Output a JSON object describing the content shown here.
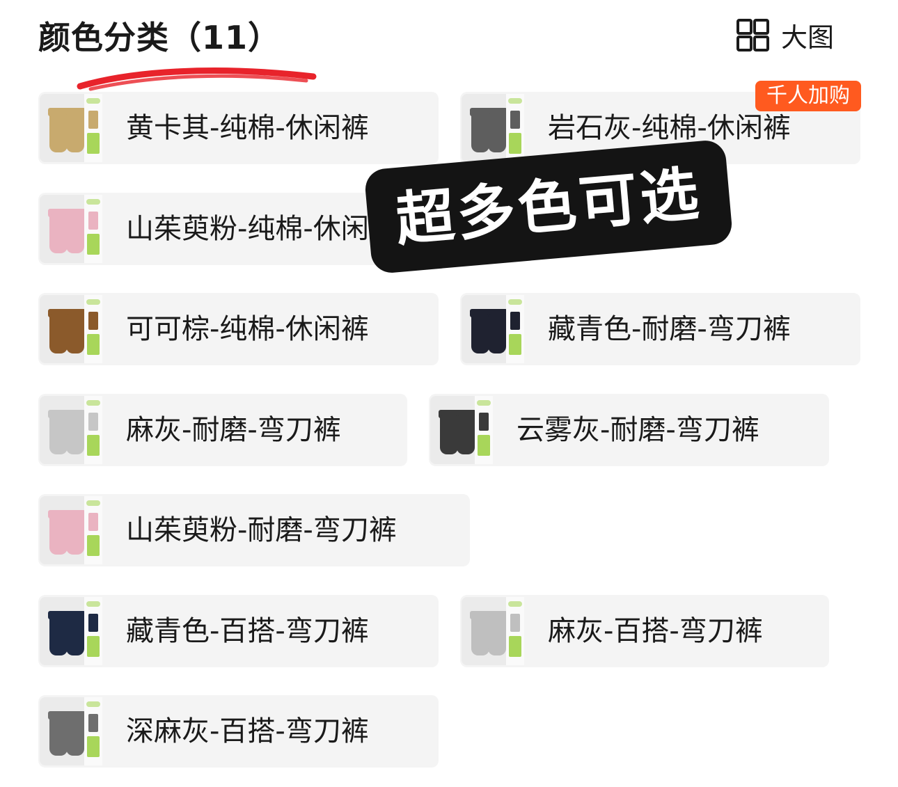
{
  "header": {
    "title": "颜色分类（11）",
    "view_label": "大图",
    "view_icon": "grid-icon"
  },
  "badge": "千人加购",
  "overlay_text": "超多色可选",
  "colors": {
    "accent_underline": "#e8232b",
    "badge_bg": "#ff5a1f",
    "chip_bg": "#f4f4f4",
    "overlay_bg": "#141414"
  },
  "options": [
    {
      "label": "黄卡其-纯棉-休闲裤",
      "swatch": "#c8aa6e"
    },
    {
      "label": "岩石灰-纯棉-休闲裤",
      "swatch": "#5e5e5e"
    },
    {
      "label": "山茱萸粉-纯棉-休闲裤",
      "swatch": "#eab3c1"
    },
    {
      "label": "可可棕-纯棉-休闲裤",
      "swatch": "#8b5a2b"
    },
    {
      "label": "藏青色-耐磨-弯刀裤",
      "swatch": "#1f2230"
    },
    {
      "label": "麻灰-耐磨-弯刀裤",
      "swatch": "#c6c6c6"
    },
    {
      "label": "云雾灰-耐磨-弯刀裤",
      "swatch": "#3a3a3a"
    },
    {
      "label": "山茱萸粉-耐磨-弯刀裤",
      "swatch": "#eab3c1"
    },
    {
      "label": "藏青色-百搭-弯刀裤",
      "swatch": "#1e2a44"
    },
    {
      "label": "麻灰-百搭-弯刀裤",
      "swatch": "#bfbfbf"
    },
    {
      "label": "深麻灰-百搭-弯刀裤",
      "swatch": "#6e6e6e"
    }
  ]
}
